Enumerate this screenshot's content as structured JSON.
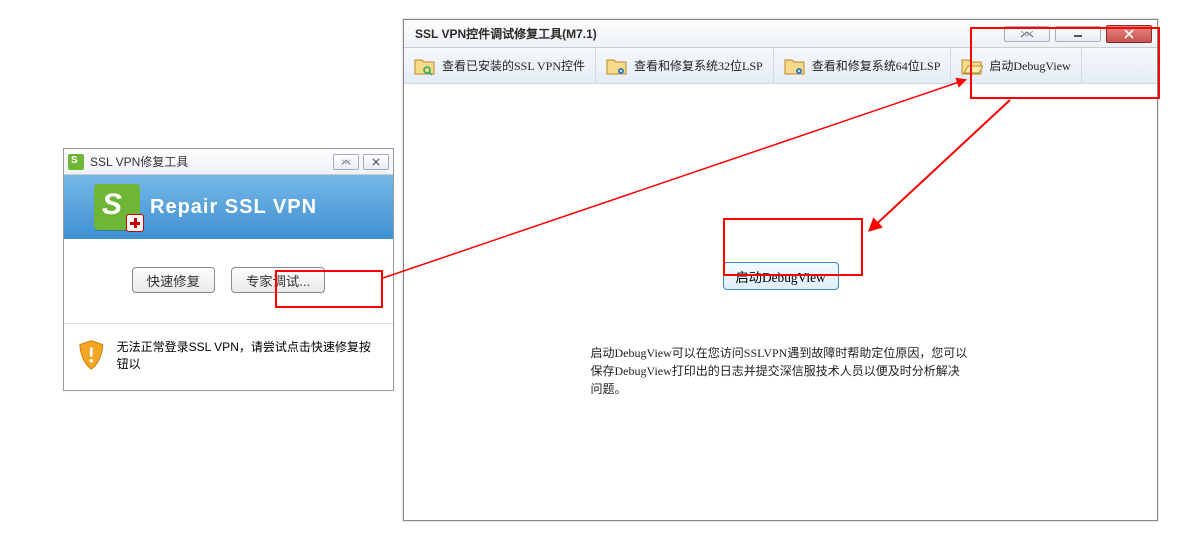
{
  "small": {
    "title": "SSL VPN修复工具",
    "banner_title": "Repair SSL VPN",
    "quick_repair_label": "快速修复",
    "expert_debug_label": "专家调试...",
    "footer_text": "无法正常登录SSL VPN，请尝试点击快速修复按钮以"
  },
  "big": {
    "title": "SSL VPN控件调试修复工具(M7.1)",
    "toolbar": {
      "view_installed": "查看已安装的SSL VPN控件",
      "fix_32": "查看和修复系统32位LSP",
      "fix_64": "查看和修复系统64位LSP",
      "launch_debugview": "启动DebugView"
    },
    "center_button": "启动DebugView",
    "description": "启动DebugView可以在您访问SSLVPN遇到故障时帮助定位原因，您可以保存DebugView打印出的日志并提交深信服技术人员以便及时分析解决问题。"
  }
}
